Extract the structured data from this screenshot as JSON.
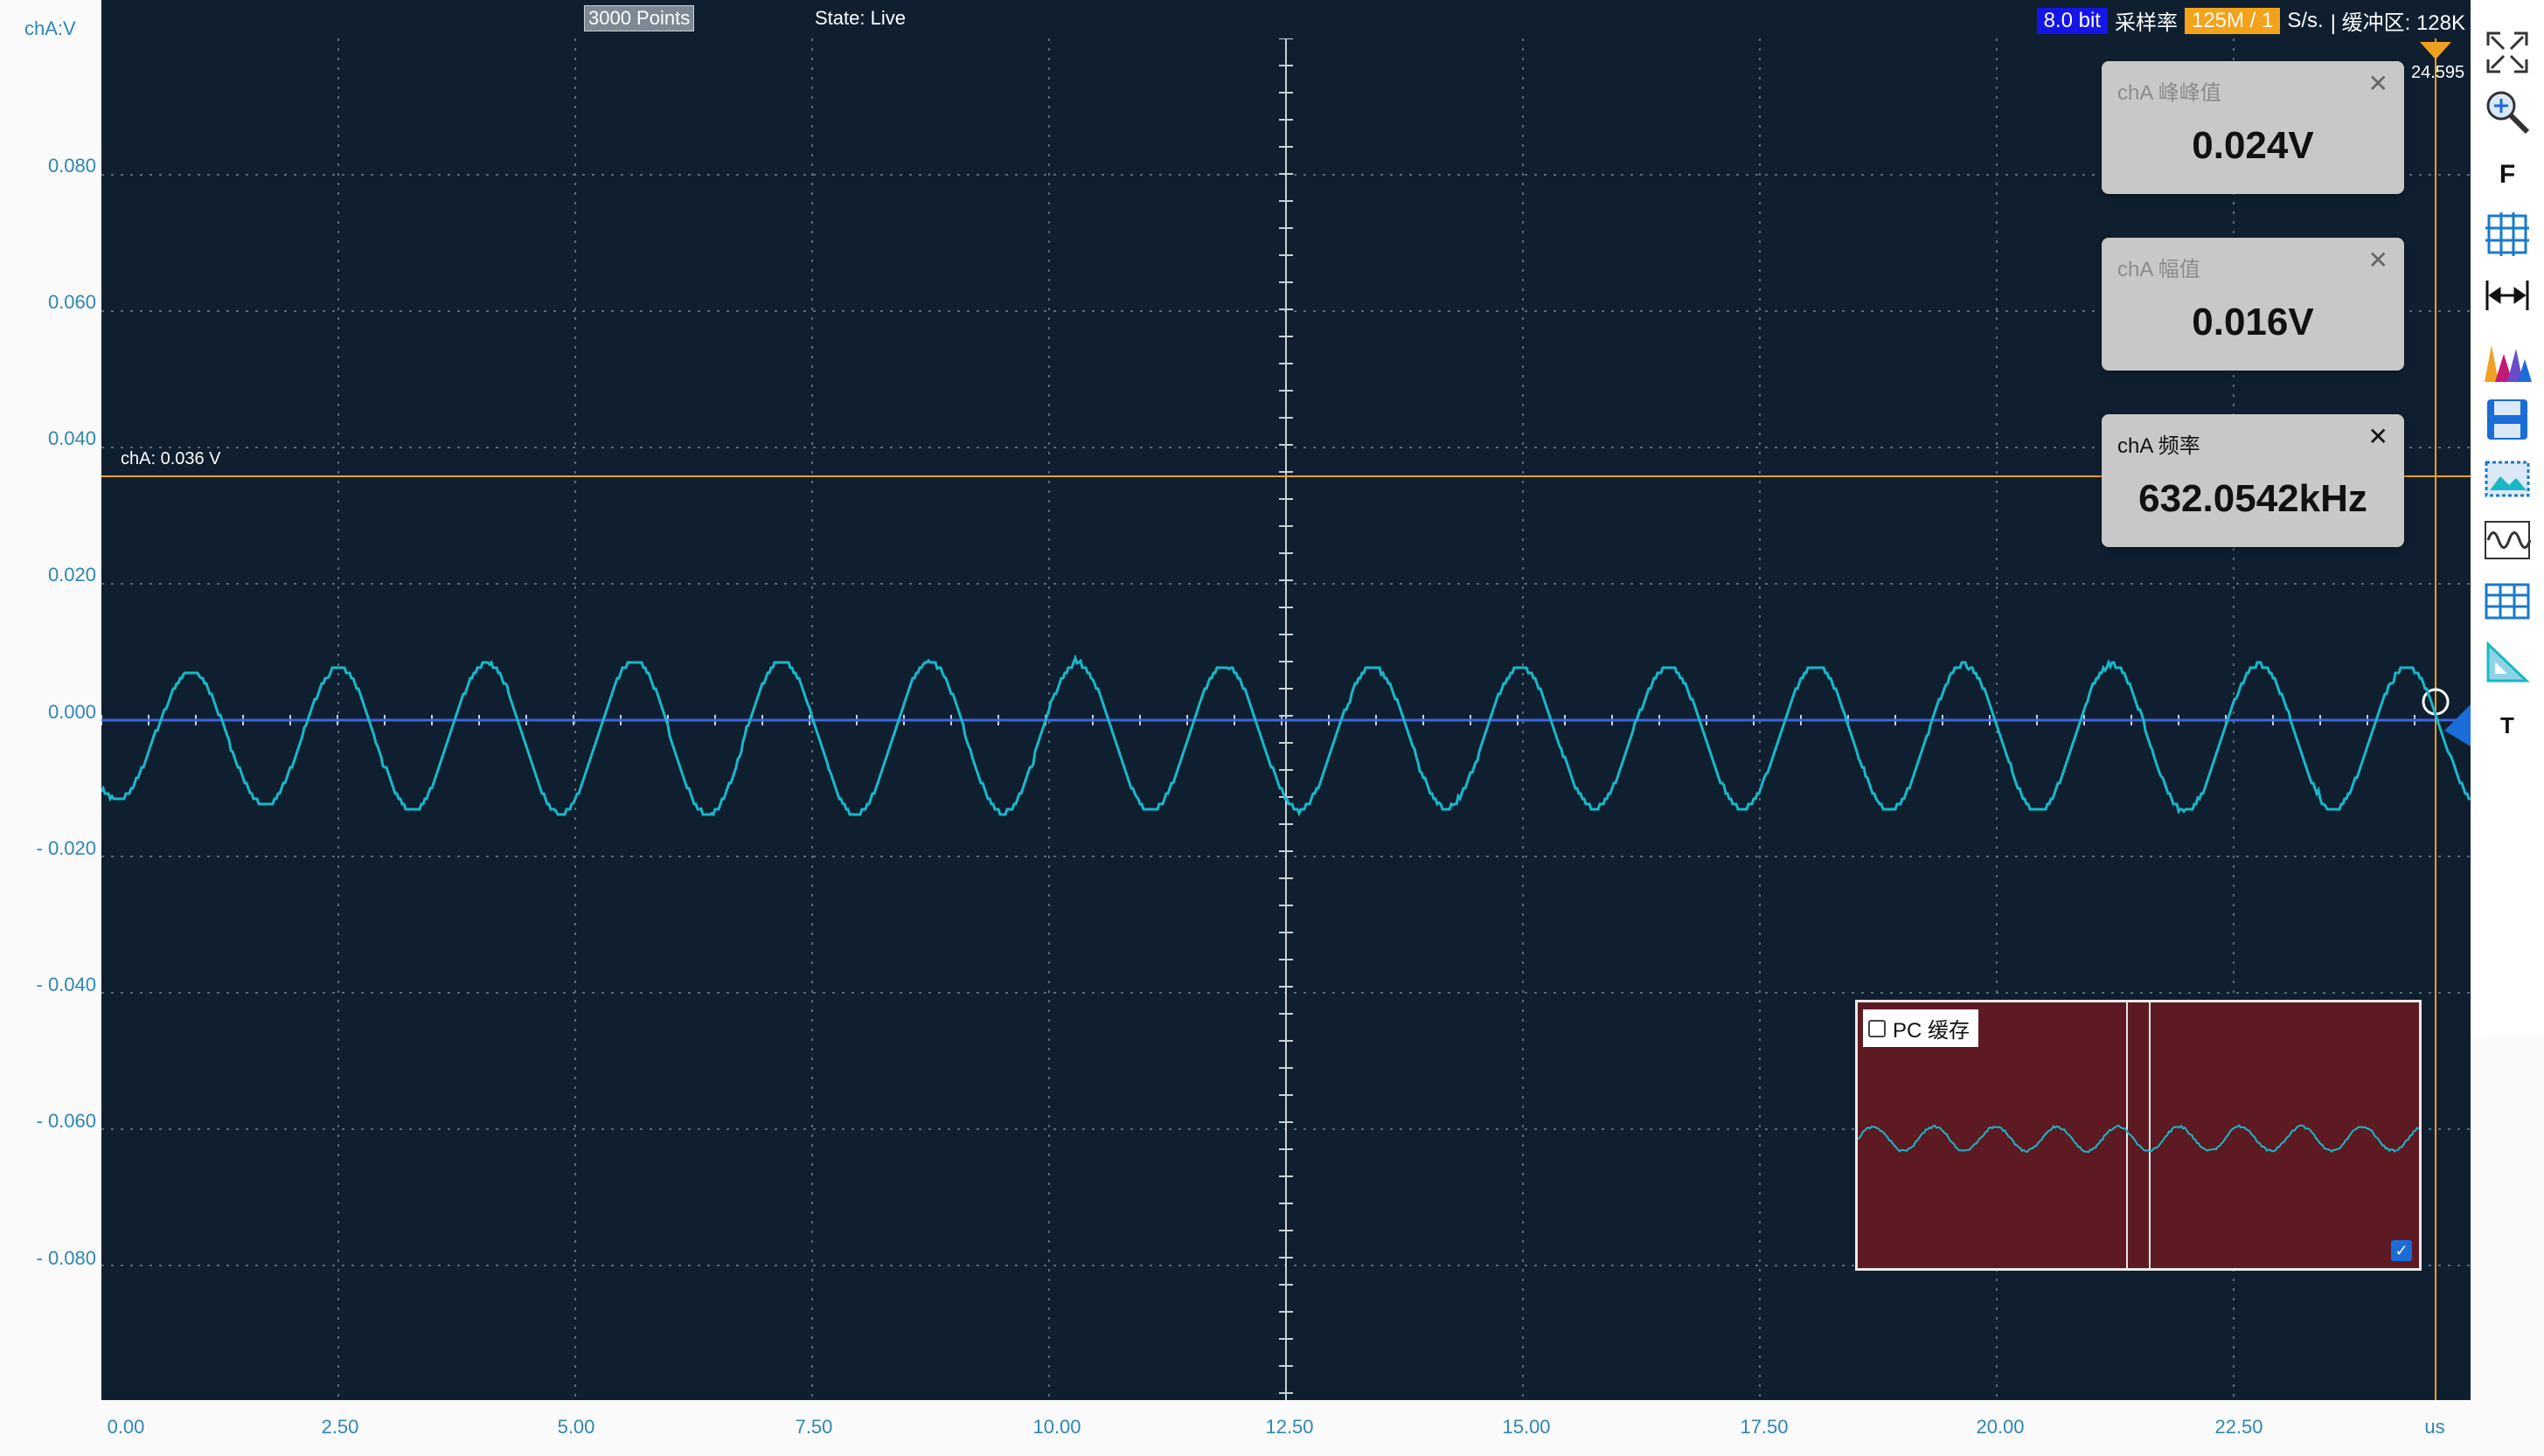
{
  "axis": {
    "channel_unit": "chA:V",
    "y_ticks": [
      "0.080",
      "0.060",
      "0.040",
      "0.020",
      "0.000",
      "- 0.020",
      "- 0.040",
      "- 0.060",
      "- 0.080"
    ],
    "x_ticks": [
      "0.00",
      "2.50",
      "5.00",
      "7.50",
      "10.00",
      "12.50",
      "15.00",
      "17.50",
      "20.00",
      "22.50"
    ],
    "x_unit": "us"
  },
  "status_bar": {
    "points": "3000 Points",
    "state": "State: Live",
    "bits": "8.0 bit",
    "sample_rate_label": "采样率",
    "sample_rate_value": "125M / 1",
    "sample_rate_unit": "S/s.",
    "buffer_label": "| 缓冲区: 128K"
  },
  "trigger": {
    "level_label": "chA: 0.036 V",
    "cursor_label": "24.595"
  },
  "measurements": [
    {
      "title": "chA 峰峰值",
      "value": "0.024V"
    },
    {
      "title": "chA 幅值",
      "value": "0.016V"
    },
    {
      "title": "chA 频率",
      "value": "632.0542kHz"
    }
  ],
  "pc_cache": {
    "label": "PC 缓存"
  },
  "toolbar": {
    "f_label": "F",
    "t_label": "T"
  },
  "colors": {
    "plot_bg": "#0f1f30",
    "waveform": "#19b8c8",
    "zero_line": "#3d66e6",
    "trigger_line": "#f0a020",
    "axis_text": "#2f86b6"
  }
}
